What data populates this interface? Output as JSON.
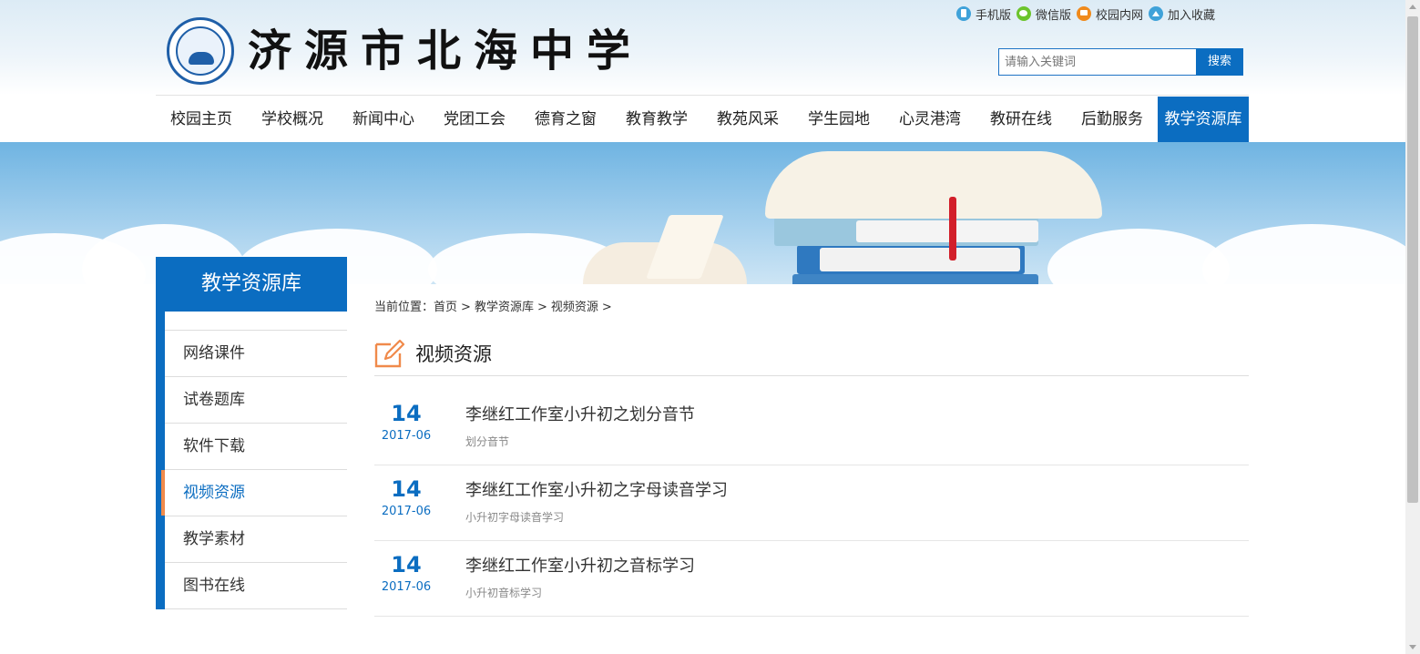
{
  "header": {
    "school_name": "济源市北海中学",
    "toplinks": [
      {
        "label": "手机版",
        "icon": "mobile-icon"
      },
      {
        "label": "微信版",
        "icon": "wechat-icon"
      },
      {
        "label": "校园内网",
        "icon": "intranet-icon"
      },
      {
        "label": "加入收藏",
        "icon": "favorite-icon"
      }
    ],
    "search": {
      "placeholder": "请输入关键词",
      "button_label": "搜索"
    }
  },
  "nav": {
    "items": [
      "校园主页",
      "学校概况",
      "新闻中心",
      "党团工会",
      "德育之窗",
      "教育教学",
      "教苑风采",
      "学生园地",
      "心灵港湾",
      "教研在线",
      "后勤服务",
      "教学资源库"
    ],
    "active_index": 11
  },
  "sidebar": {
    "title": "教学资源库",
    "items": [
      "网络课件",
      "试卷题库",
      "软件下载",
      "视频资源",
      "教学素材",
      "图书在线"
    ],
    "active_index": 3
  },
  "breadcrumb": {
    "prefix": "当前位置：",
    "items": [
      "首页",
      "教学资源库",
      "视频资源"
    ],
    "separator": ">"
  },
  "section": {
    "title": "视频资源"
  },
  "news": [
    {
      "day": "14",
      "year_month": "2017-06",
      "title": "李继红工作室小升初之划分音节",
      "desc": "划分音节"
    },
    {
      "day": "14",
      "year_month": "2017-06",
      "title": "李继红工作室小升初之字母读音学习",
      "desc": "小升初字母读音学习"
    },
    {
      "day": "14",
      "year_month": "2017-06",
      "title": "李继红工作室小升初之音标学习",
      "desc": "小升初音标学习"
    }
  ],
  "colors": {
    "primary": "#0b6dc1",
    "accent": "#f08a4b"
  }
}
